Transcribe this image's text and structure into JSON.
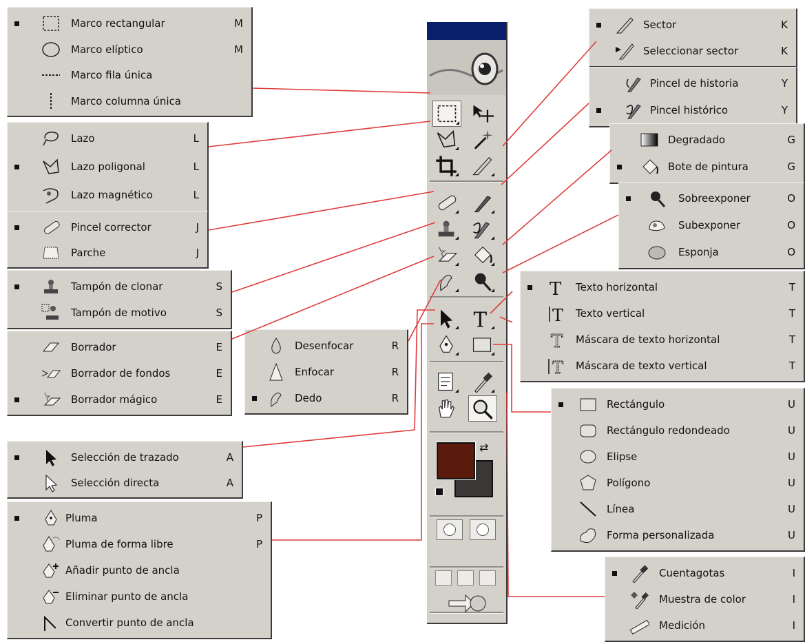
{
  "panels": {
    "marquee": [
      {
        "label": "Marco rectangular",
        "key": "M",
        "selected": true,
        "icon": "rect-marquee-icon"
      },
      {
        "label": "Marco elíptico",
        "key": "M",
        "selected": false,
        "icon": "ellipse-marquee-icon"
      },
      {
        "label": "Marco fila única",
        "key": "",
        "selected": false,
        "icon": "row-marquee-icon"
      },
      {
        "label": "Marco columna única",
        "key": "",
        "selected": false,
        "icon": "column-marquee-icon"
      }
    ],
    "lasso": [
      {
        "label": "Lazo",
        "key": "L",
        "selected": false,
        "icon": "lasso-icon"
      },
      {
        "label": "Lazo poligonal",
        "key": "L",
        "selected": true,
        "icon": "polygonal-lasso-icon"
      },
      {
        "label": "Lazo magnético",
        "key": "L",
        "selected": false,
        "icon": "magnetic-lasso-icon"
      }
    ],
    "healing": [
      {
        "label": "Pincel corrector",
        "key": "J",
        "selected": true,
        "icon": "healing-brush-icon"
      },
      {
        "label": "Parche",
        "key": "J",
        "selected": false,
        "icon": "patch-icon"
      }
    ],
    "stamp": [
      {
        "label": "Tampón de clonar",
        "key": "S",
        "selected": true,
        "icon": "clone-stamp-icon"
      },
      {
        "label": "Tampón de motivo",
        "key": "S",
        "selected": false,
        "icon": "pattern-stamp-icon"
      }
    ],
    "eraser": [
      {
        "label": "Borrador",
        "key": "E",
        "selected": false,
        "icon": "eraser-icon"
      },
      {
        "label": "Borrador de fondos",
        "key": "E",
        "selected": false,
        "icon": "background-eraser-icon"
      },
      {
        "label": "Borrador mágico",
        "key": "E",
        "selected": true,
        "icon": "magic-eraser-icon"
      }
    ],
    "blur": [
      {
        "label": "Desenfocar",
        "key": "R",
        "selected": false,
        "icon": "blur-icon"
      },
      {
        "label": "Enfocar",
        "key": "R",
        "selected": false,
        "icon": "sharpen-icon"
      },
      {
        "label": "Dedo",
        "key": "R",
        "selected": true,
        "icon": "smudge-icon"
      }
    ],
    "path_select": [
      {
        "label": "Selección de trazado",
        "key": "A",
        "selected": true,
        "icon": "path-selection-icon"
      },
      {
        "label": "Selección directa",
        "key": "A",
        "selected": false,
        "icon": "direct-selection-icon"
      }
    ],
    "pen": [
      {
        "label": "Pluma",
        "key": "P",
        "selected": true,
        "icon": "pen-icon"
      },
      {
        "label": "Pluma de forma libre",
        "key": "P",
        "selected": false,
        "icon": "freeform-pen-icon"
      },
      {
        "label": "Añadir punto de ancla",
        "key": "",
        "selected": false,
        "icon": "add-anchor-icon"
      },
      {
        "label": "Eliminar punto de ancla",
        "key": "",
        "selected": false,
        "icon": "delete-anchor-icon"
      },
      {
        "label": "Convertir punto de ancla",
        "key": "",
        "selected": false,
        "icon": "convert-anchor-icon"
      }
    ],
    "slice": [
      {
        "label": "Sector",
        "key": "K",
        "selected": true,
        "icon": "slice-icon"
      },
      {
        "label": "Seleccionar sector",
        "key": "K",
        "selected": false,
        "icon": "slice-select-icon"
      }
    ],
    "history": [
      {
        "label": "Pincel de historia",
        "key": "Y",
        "selected": false,
        "icon": "history-brush-icon"
      },
      {
        "label": "Pincel histórico",
        "key": "Y",
        "selected": true,
        "icon": "art-history-brush-icon"
      }
    ],
    "gradient": [
      {
        "label": "Degradado",
        "key": "G",
        "selected": false,
        "icon": "gradient-icon"
      },
      {
        "label": "Bote de pintura",
        "key": "G",
        "selected": true,
        "icon": "paint-bucket-icon"
      }
    ],
    "dodge": [
      {
        "label": "Sobreexponer",
        "key": "O",
        "selected": true,
        "icon": "dodge-icon"
      },
      {
        "label": "Subexponer",
        "key": "O",
        "selected": false,
        "icon": "burn-icon"
      },
      {
        "label": "Esponja",
        "key": "O",
        "selected": false,
        "icon": "sponge-icon"
      }
    ],
    "type": [
      {
        "label": "Texto horizontal",
        "key": "T",
        "selected": true,
        "icon": "horizontal-type-icon"
      },
      {
        "label": "Texto vertical",
        "key": "T",
        "selected": false,
        "icon": "vertical-type-icon"
      },
      {
        "label": "Máscara de texto horizontal",
        "key": "T",
        "selected": false,
        "icon": "horizontal-type-mask-icon"
      },
      {
        "label": "Máscara de texto vertical",
        "key": "T",
        "selected": false,
        "icon": "vertical-type-mask-icon"
      }
    ],
    "shape": [
      {
        "label": "Rectángulo",
        "key": "U",
        "selected": true,
        "icon": "rectangle-icon"
      },
      {
        "label": "Rectángulo redondeado",
        "key": "U",
        "selected": false,
        "icon": "rounded-rectangle-icon"
      },
      {
        "label": "Elipse",
        "key": "U",
        "selected": false,
        "icon": "ellipse-icon"
      },
      {
        "label": "Polígono",
        "key": "U",
        "selected": false,
        "icon": "polygon-icon"
      },
      {
        "label": "Línea",
        "key": "U",
        "selected": false,
        "icon": "line-icon"
      },
      {
        "label": "Forma personalizada",
        "key": "U",
        "selected": false,
        "icon": "custom-shape-icon"
      }
    ],
    "eyedropper": [
      {
        "label": "Cuentagotas",
        "key": "I",
        "selected": true,
        "icon": "eyedropper-icon"
      },
      {
        "label": "Muestra de color",
        "key": "I",
        "selected": false,
        "icon": "color-sampler-icon"
      },
      {
        "label": "Medición",
        "key": "I",
        "selected": false,
        "icon": "measure-icon"
      }
    ]
  },
  "toolbar": {
    "title_color": "#0a1f6b",
    "foreground_color": "#5a1a0c",
    "background_color": "#3a3836"
  },
  "connector_color": "#e03a3a"
}
